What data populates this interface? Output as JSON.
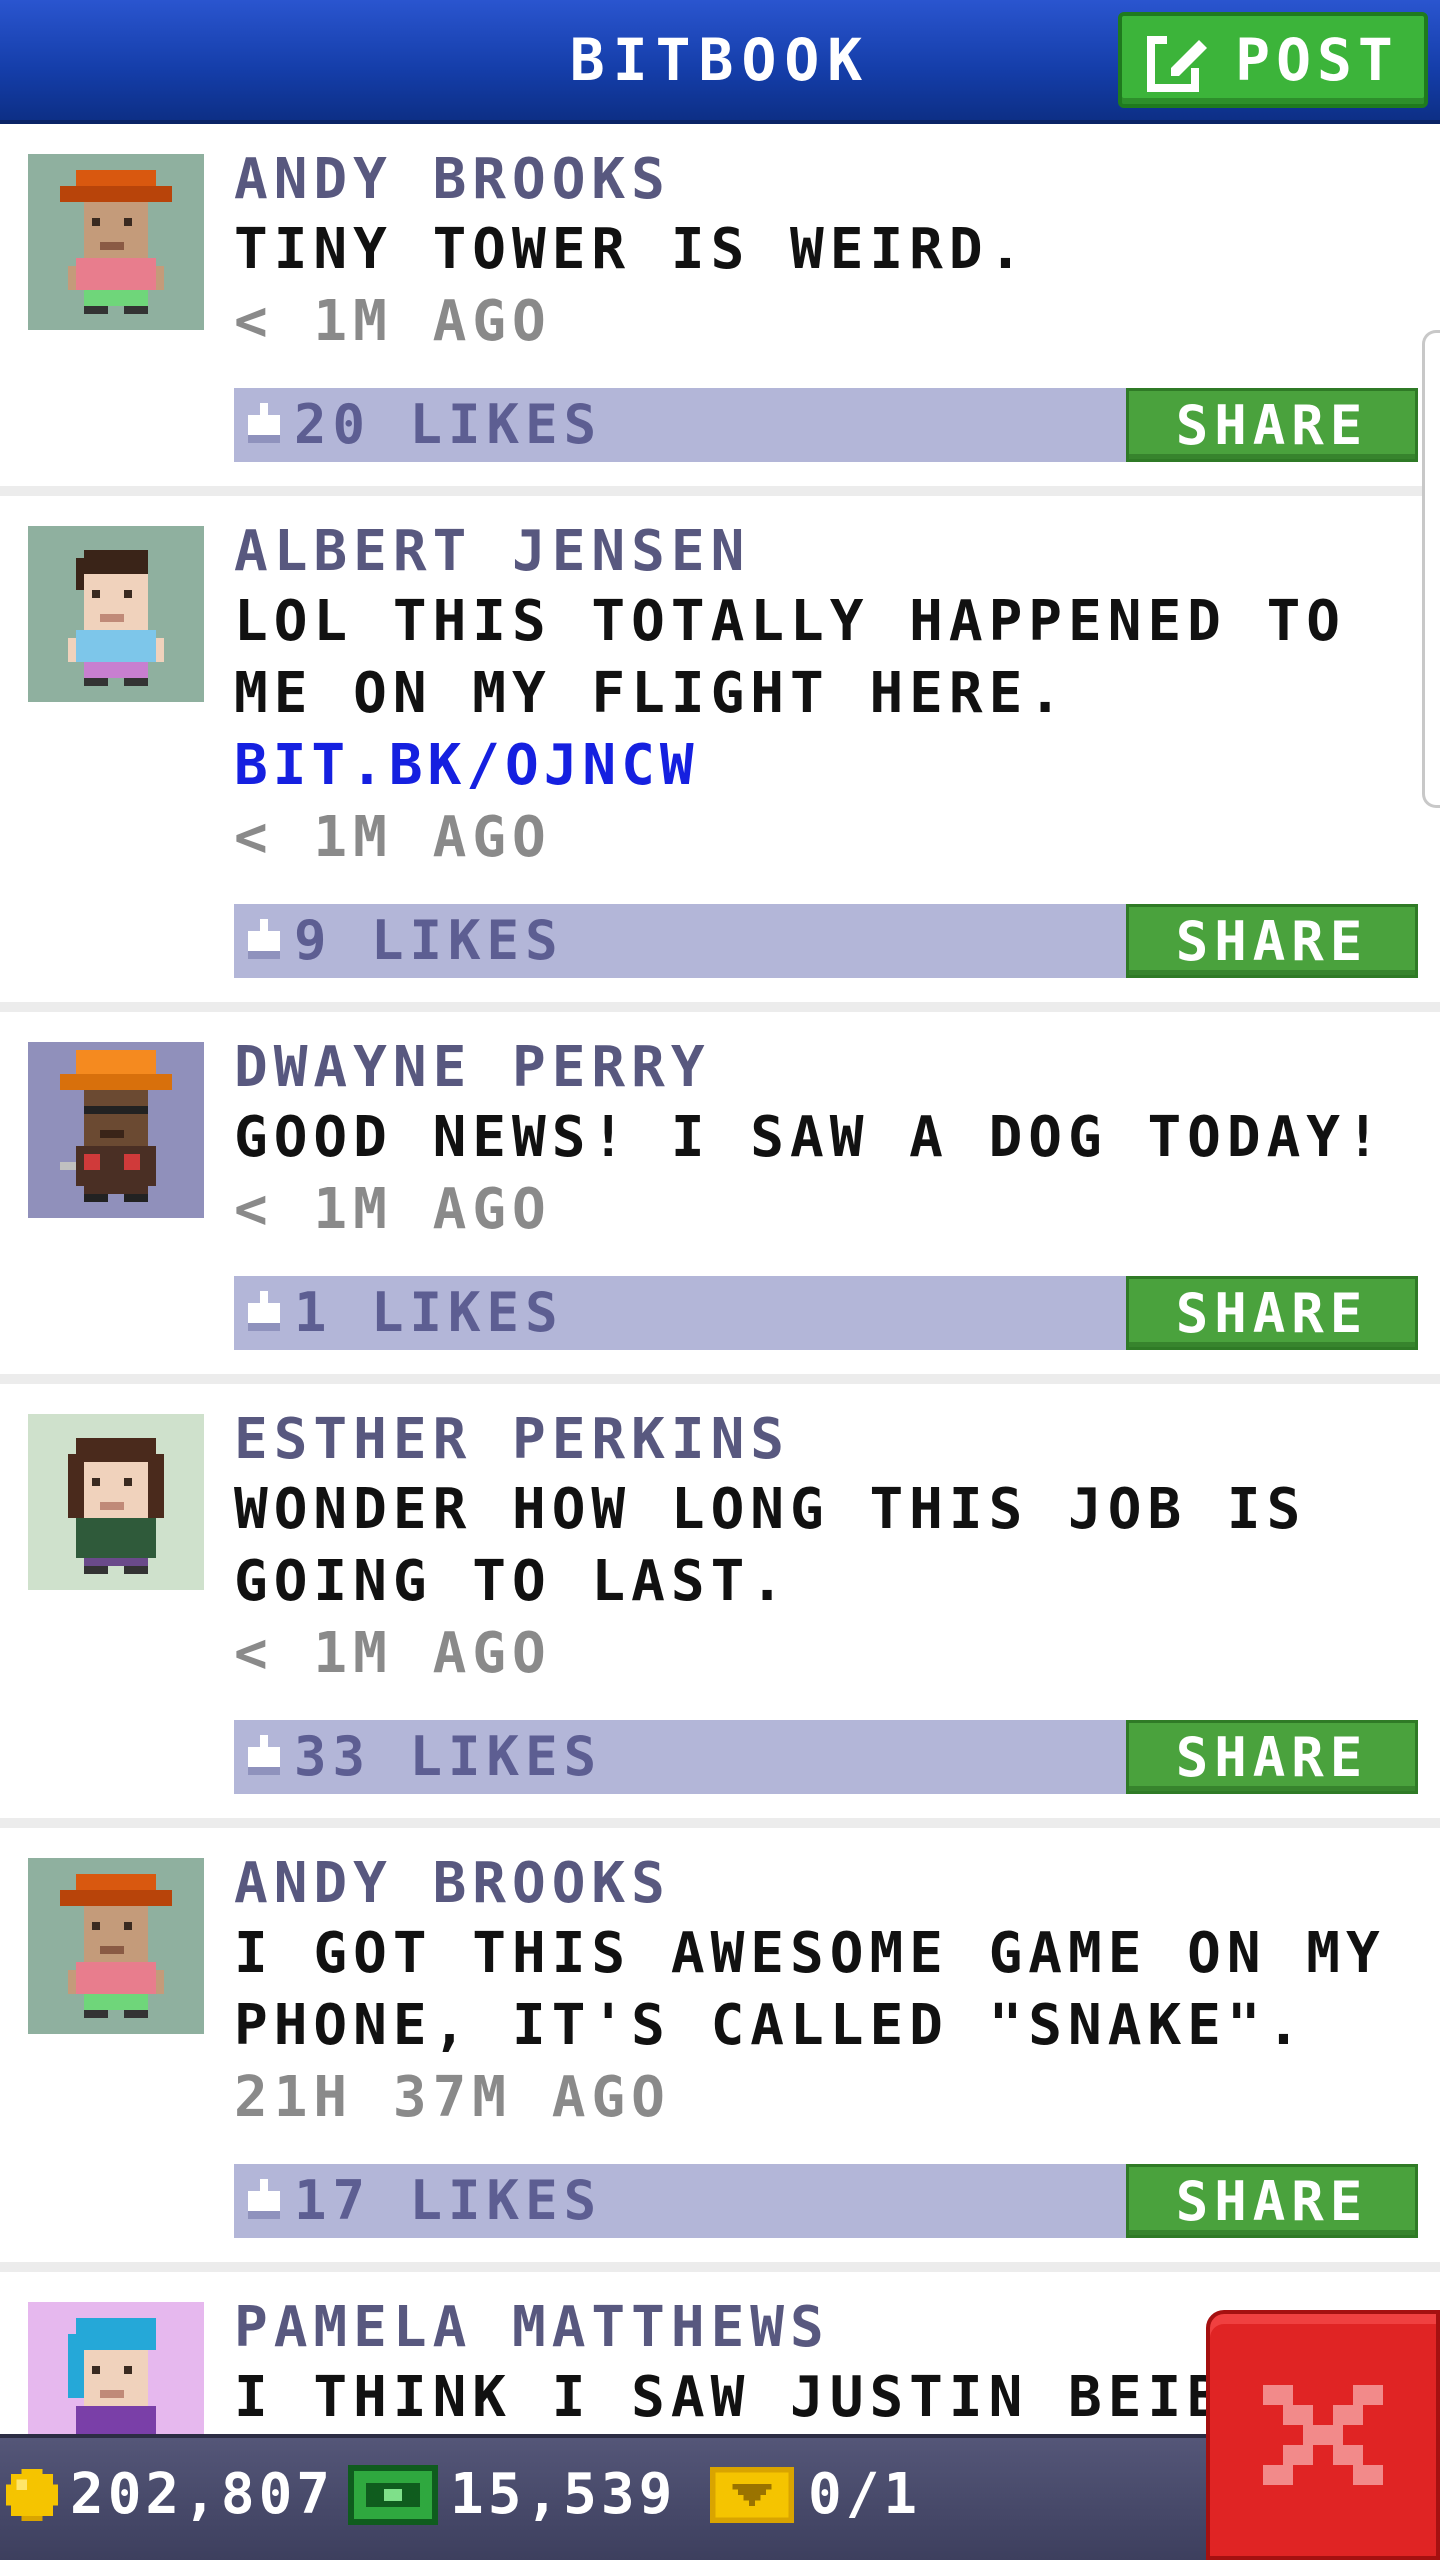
{
  "header": {
    "title": "BITBOOK",
    "post_label": "POST"
  },
  "posts": [
    {
      "author": "ANDY BROOKS",
      "message": "TINY TOWER IS WEIRD.",
      "link": "",
      "time": "< 1M AGO",
      "likes": "20 LIKES",
      "share_label": "SHARE",
      "avatar": "andy-brooks-avatar"
    },
    {
      "author": "ALBERT JENSEN",
      "message": "LOL THIS TOTALLY HAPPENED TO ME ON MY FLIGHT HERE.",
      "link": "BIT.BK/OJNCW",
      "time": "< 1M AGO",
      "likes": "9 LIKES",
      "share_label": "SHARE",
      "avatar": "albert-jensen-avatar"
    },
    {
      "author": "DWAYNE PERRY",
      "message": "GOOD NEWS! I SAW A DOG TODAY!",
      "link": "",
      "time": "< 1M AGO",
      "likes": "1 LIKES",
      "share_label": "SHARE",
      "avatar": "dwayne-perry-avatar"
    },
    {
      "author": "ESTHER PERKINS",
      "message": "WONDER HOW LONG THIS JOB IS GOING TO LAST.",
      "link": "",
      "time": "< 1M AGO",
      "likes": "33 LIKES",
      "share_label": "SHARE",
      "avatar": "esther-perkins-avatar"
    },
    {
      "author": "ANDY BROOKS",
      "message": "I GOT THIS AWESOME GAME ON MY PHONE, IT'S CALLED \"SNAKE\".",
      "link": "",
      "time": "21H 37M AGO",
      "likes": "17 LIKES",
      "share_label": "SHARE",
      "avatar": "andy-brooks-avatar"
    },
    {
      "author": "PAMELA MATTHEWS",
      "message": "I THINK I SAW JUSTIN BEIBER! DO",
      "link": "",
      "time": "",
      "likes": "",
      "share_label": "",
      "avatar": "pamela-matthews-avatar"
    }
  ],
  "bottom_bar": {
    "coins": "202,807",
    "bux": "15,539",
    "vip": "0/1"
  },
  "colors": {
    "header_blue": "#1a45b8",
    "post_green": "#3cb43a",
    "like_bar": "#b3b6d8",
    "author_text": "#58587f",
    "link_blue": "#1520e0",
    "close_red": "#e02424"
  }
}
